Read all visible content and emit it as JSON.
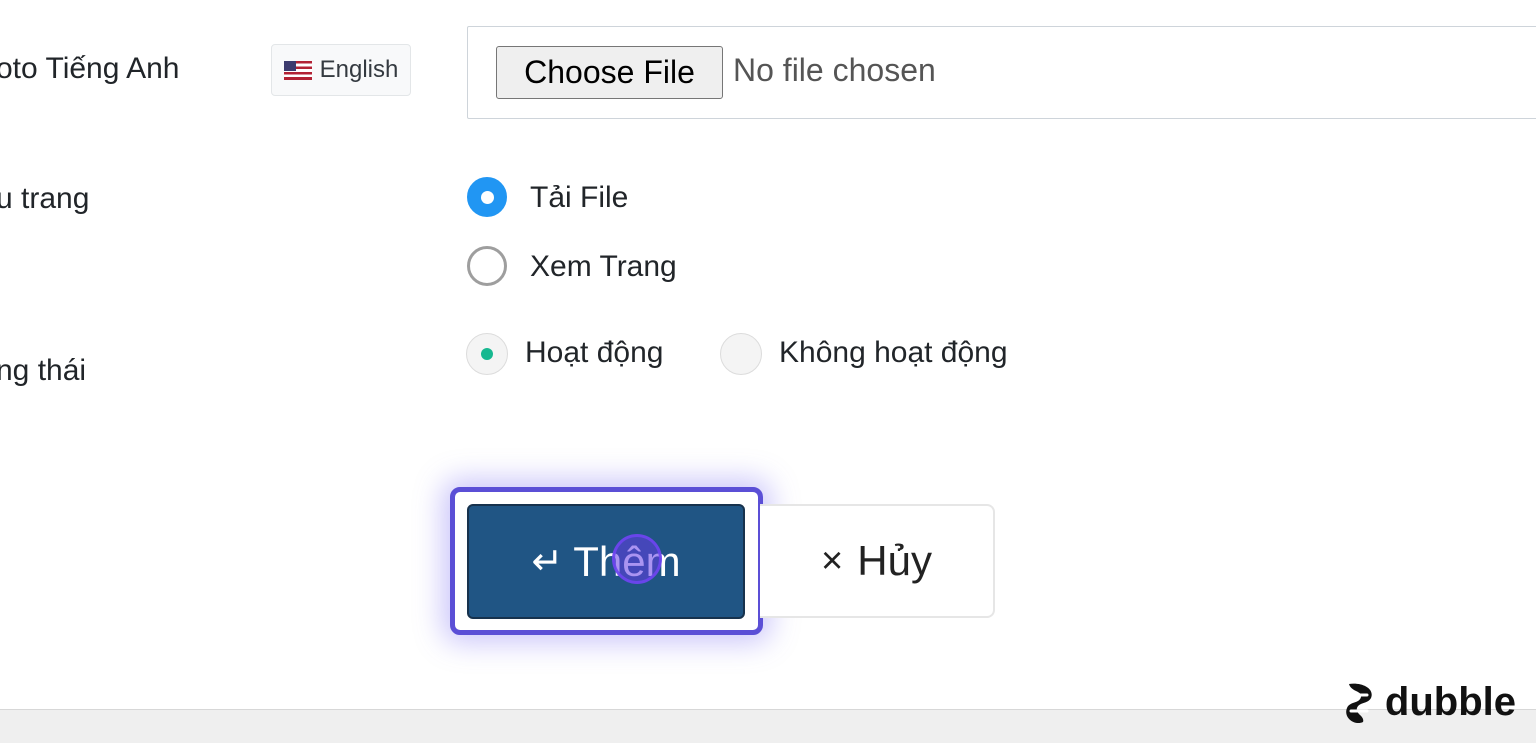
{
  "form": {
    "photo_en_label": "oto Tiếng Anh",
    "lang_badge": "English",
    "file_input": {
      "button_label": "Choose File",
      "status": "No file chosen"
    },
    "page_type_label": "u trang",
    "page_type_options": [
      "Tải File",
      "Xem Trang"
    ],
    "status_label": "ng thái",
    "status_options": [
      "Hoạt động",
      "Không hoạt động"
    ]
  },
  "actions": {
    "add_icon": "↵",
    "add_label": "Thêm",
    "cancel_icon": "×",
    "cancel_label": "Hủy"
  },
  "watermark": {
    "brand": "dubble"
  },
  "colors": {
    "primary": "#205584",
    "radio_checked": "#2196f3",
    "status_active": "#17b890",
    "focus_ring": "#5b4fd6"
  }
}
